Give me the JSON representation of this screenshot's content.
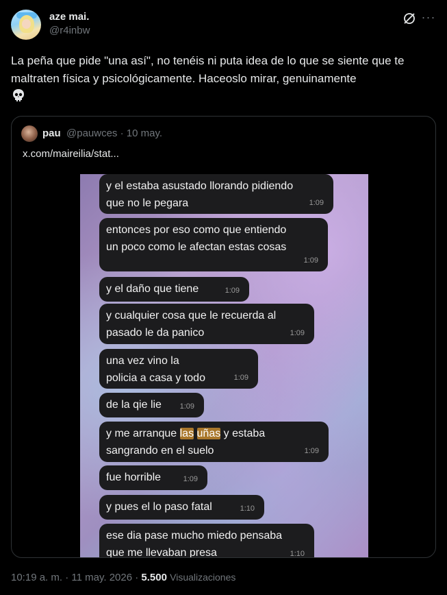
{
  "author": {
    "name": "aze mai.",
    "handle": "@r4inbw"
  },
  "tweet": {
    "text": "La peña que pide \"una así\", no tenéis ni puta idea de lo que se siente que te maltraten física y psicológicamente. Haceoslo mirar, genuinamente"
  },
  "quote": {
    "name": "pau",
    "handle": "@pauwces",
    "separator": "·",
    "date": "10 may.",
    "link": "x.com/maireilia/stat..."
  },
  "chat": {
    "messages": [
      {
        "line1": "y el estaba asustado llorando pidiendo",
        "line2": "que no le pegara",
        "time": "1:09"
      },
      {
        "line1": "entonces por eso como que entiendo",
        "line2": "un poco como le afectan estas cosas",
        "time": "1:09"
      },
      {
        "line1": "y el daño que tiene",
        "time": "1:09"
      },
      {
        "line1": "y cualquier cosa que le recuerda al",
        "line2": "pasado le da panico",
        "time": "1:09"
      },
      {
        "line1": "una vez vino la",
        "line2": "policia a casa y todo",
        "time": "1:09"
      },
      {
        "line1": "de la qie lie",
        "time": "1:09"
      },
      {
        "line1_pre": "y me arranque ",
        "hl1": "las",
        "hl2": "uñas",
        "line1_post": " y estaba",
        "line2": "sangrando en el suelo",
        "time": "1:09"
      },
      {
        "line1": "fue horrible",
        "time": "1:09"
      },
      {
        "line1": "y pues el lo paso fatal",
        "time": "1:10"
      },
      {
        "line1": "ese dia pase mucho miedo pensaba",
        "line2": "que me llevaban presa",
        "time": "1:10"
      }
    ]
  },
  "footer": {
    "time": "10:19 a. m.",
    "separator": "·",
    "date": "11 may. 2026",
    "views_count": "5.500",
    "views_label": "Visualizaciones"
  },
  "icons": {
    "more": "more-icon",
    "grok": "grok-icon",
    "skull": "skull-icon"
  }
}
